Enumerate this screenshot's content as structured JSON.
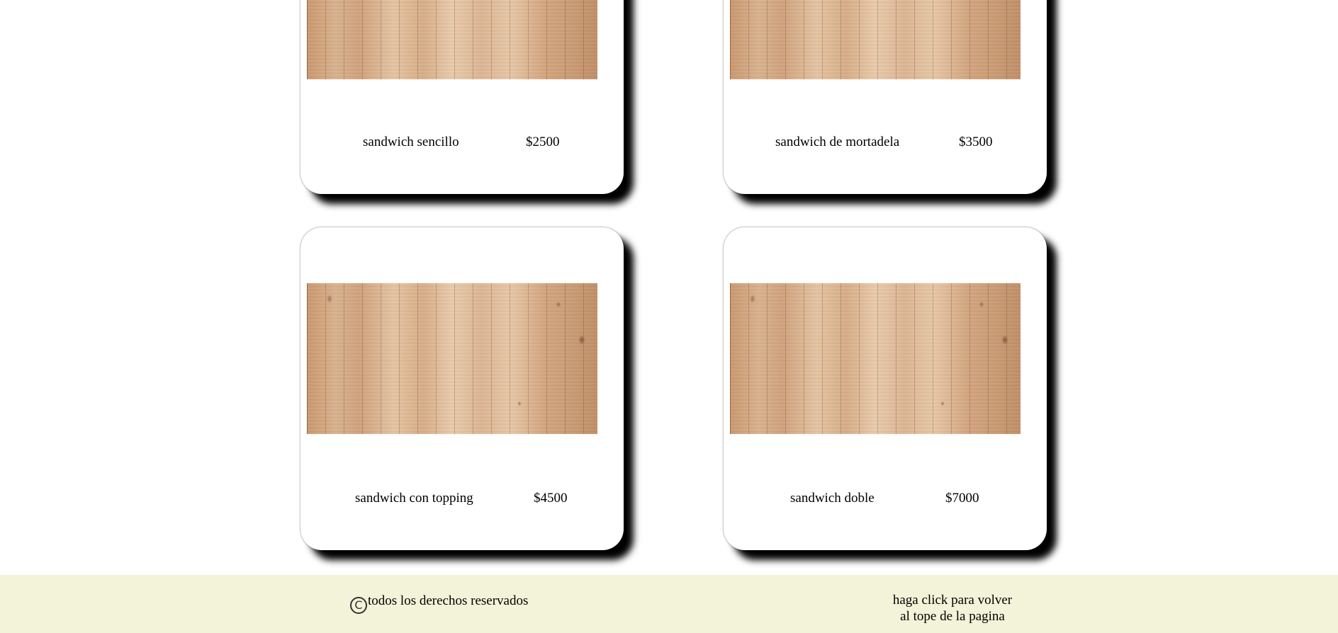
{
  "products": [
    {
      "name": "sandwich sencillo",
      "price": "$2500"
    },
    {
      "name": "sandwich de mortadela",
      "price": "$3500"
    },
    {
      "name": "sandwich con topping",
      "price": "$4500"
    },
    {
      "name": "sandwich doble",
      "price": "$7000"
    }
  ],
  "footer": {
    "copyright_symbol": "C",
    "copyright_text": "todos los derechos reservados",
    "back_to_top_line1": "haga click para volver",
    "back_to_top_line2": "al tope de la pagina"
  },
  "colors": {
    "footer_background": "#f3f3d9",
    "card_background": "#ffffff",
    "card_shadow": "#000000"
  }
}
